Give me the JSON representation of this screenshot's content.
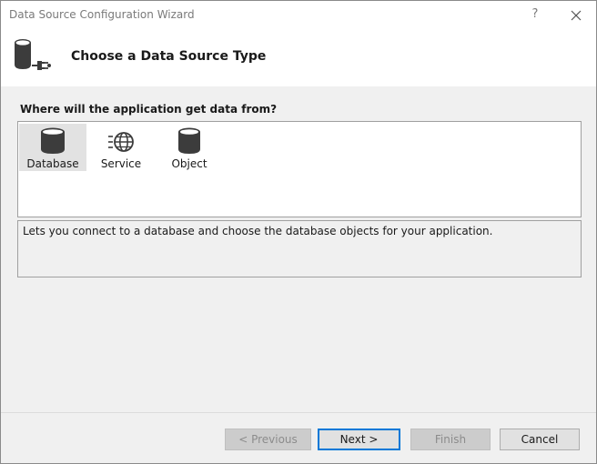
{
  "window": {
    "title": "Data Source Configuration Wizard",
    "help_label": "?"
  },
  "header": {
    "title": "Choose a Data Source Type",
    "icon": "database-connector-icon"
  },
  "question": "Where will the application get data from?",
  "source_types": [
    {
      "label": "Database",
      "icon": "database-icon",
      "selected": true
    },
    {
      "label": "Service",
      "icon": "web-service-icon",
      "selected": false
    },
    {
      "label": "Object",
      "icon": "object-icon",
      "selected": false
    }
  ],
  "description": "Lets you connect to a database and choose the database objects for your application.",
  "buttons": {
    "previous": "< Previous",
    "next": "Next >",
    "finish": "Finish",
    "cancel": "Cancel"
  },
  "colors": {
    "accent": "#0078d7",
    "selection": "#e2e2e2",
    "icon": "#3c3c3c"
  }
}
